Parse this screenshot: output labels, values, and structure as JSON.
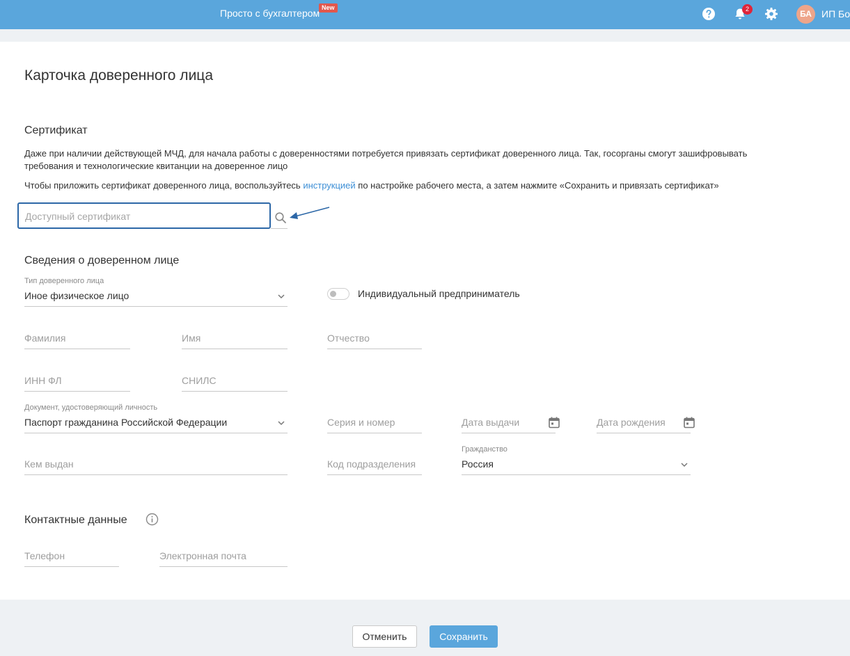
{
  "header": {
    "brand": "Просто с бухгалтером",
    "new_badge": "New",
    "notifications_count": "2",
    "avatar_initials": "БА",
    "user_name": "ИП Бор"
  },
  "page": {
    "title": "Карточка доверенного лица"
  },
  "certificate": {
    "section_title": "Сертификат",
    "description_line1": "Даже при наличии действующей МЧД, для начала работы с доверенностями потребуется привязать сертификат доверенного лица. Так, госорганы смогут зашифровывать",
    "description_line2": "требования и технологические квитанции на доверенное лицо",
    "instruction_before": "Чтобы приложить сертификат доверенного лица, воспользуйтесь ",
    "instruction_link": "инструкцией",
    "instruction_after": " по настройке рабочего места, а затем нажмите «Сохранить и привязать сертификат»",
    "placeholder": "Доступный сертификат"
  },
  "person": {
    "section_title": "Сведения о доверенном лице",
    "type_label": "Тип доверенного лица",
    "type_value": "Иное физическое лицо",
    "ip_toggle_label": "Индивидуальный предприниматель",
    "ip_toggle_on": false,
    "last_name": "Фамилия",
    "first_name": "Имя",
    "patronymic": "Отчество",
    "inn": "ИНН ФЛ",
    "snils": "СНИЛС",
    "doc_label": "Документ, удостоверяющий личность",
    "doc_value": "Паспорт гражданина Российской Федерации",
    "series_number": "Серия и номер",
    "issue_date": "Дата выдачи",
    "birth_date": "Дата рождения",
    "issued_by": "Кем выдан",
    "division_code": "Код подразделения",
    "citizenship_label": "Гражданство",
    "citizenship_value": "Россия"
  },
  "contacts": {
    "section_title": "Контактные данные",
    "phone": "Телефон",
    "email": "Электронная почта"
  },
  "footer": {
    "cancel": "Отменить",
    "save": "Сохранить"
  },
  "colors": {
    "header_bg": "#5aa6dc",
    "accent": "#3d8fd6",
    "focus_border": "#2c67a7",
    "badge_red": "#e0253a"
  }
}
